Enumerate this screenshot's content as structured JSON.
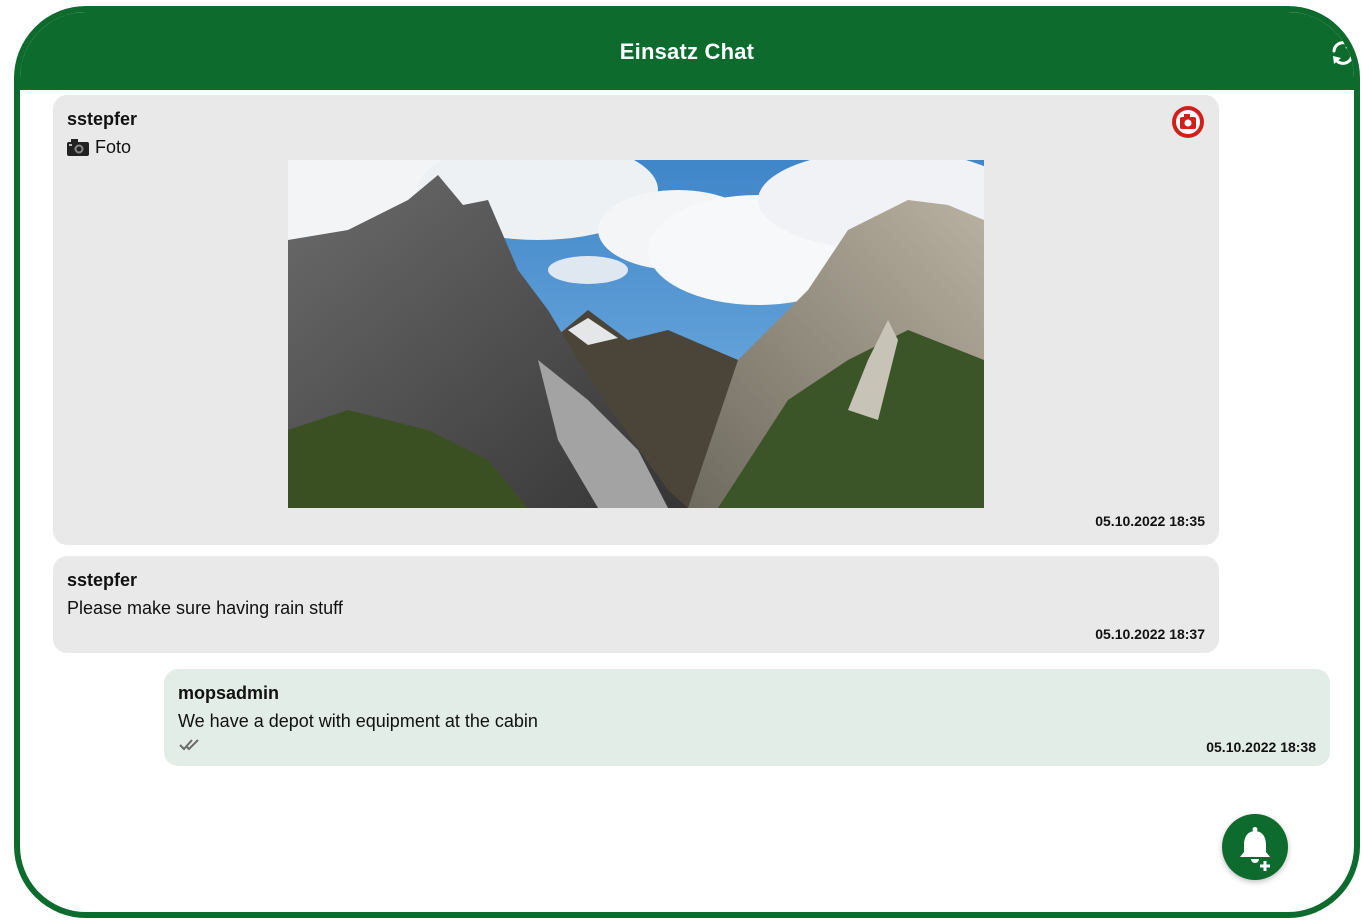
{
  "header": {
    "title": "Einsatz Chat"
  },
  "messages": [
    {
      "sender": "sstepfer",
      "type_label": "Foto",
      "timestamp": "05.10.2022 18:35"
    },
    {
      "sender": "sstepfer",
      "text": "Please make sure having rain stuff",
      "timestamp": "05.10.2022 18:37"
    },
    {
      "sender": "mopsadmin",
      "text": "We have a depot with equipment at the cabin",
      "timestamp": "05.10.2022 18:38"
    }
  ],
  "colors": {
    "brand": "#0d6b2e",
    "bubble": "#e9e9e9",
    "own_bubble": "#e2ede7",
    "camera": "#d0201b"
  }
}
